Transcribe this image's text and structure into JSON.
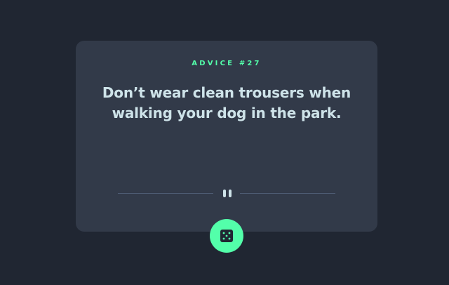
{
  "card": {
    "advice_id": "ADVICE #27",
    "quote": "Don’t wear clean trousers when walking your dog in the park."
  },
  "divider": {
    "icon": "pause-icon"
  },
  "dice_button": {
    "icon": "dice-icon"
  },
  "colors": {
    "background": "#202632",
    "card": "#323a49",
    "accent": "#53ffaa",
    "text": "#cee3e9",
    "divider": "#4f5d74"
  }
}
